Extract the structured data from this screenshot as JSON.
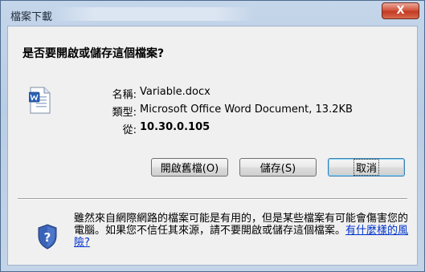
{
  "window": {
    "title": "檔案下載",
    "close_glyph": "X"
  },
  "dialog": {
    "question": "是否要開啟或儲存這個檔案?",
    "file": {
      "name_label": "名稱:",
      "name_value": "Variable.docx",
      "type_label": "類型:",
      "type_value": "Microsoft Office Word Document, 13.2KB",
      "from_label": "從:",
      "from_value": "10.30.0.105"
    },
    "buttons": {
      "open": "開啟舊檔(O)",
      "save": "儲存(S)",
      "cancel": "取消"
    },
    "warning": {
      "text": "雖然來自網際網路的檔案可能是有用的，但是某些檔案有可能會傷害您的電腦。如果您不信任其來源，請不要開啟或儲存這個檔案。",
      "link": "有什麼樣的風險?"
    }
  },
  "colors": {
    "title_gradient": "#c5d6ea",
    "close_button": "#c13a22",
    "link": "#0033cc",
    "default_button_border": "#3c7fb1"
  },
  "icons": {
    "file": "word-document-icon",
    "warning": "security-shield-question-icon",
    "close": "close-icon"
  }
}
